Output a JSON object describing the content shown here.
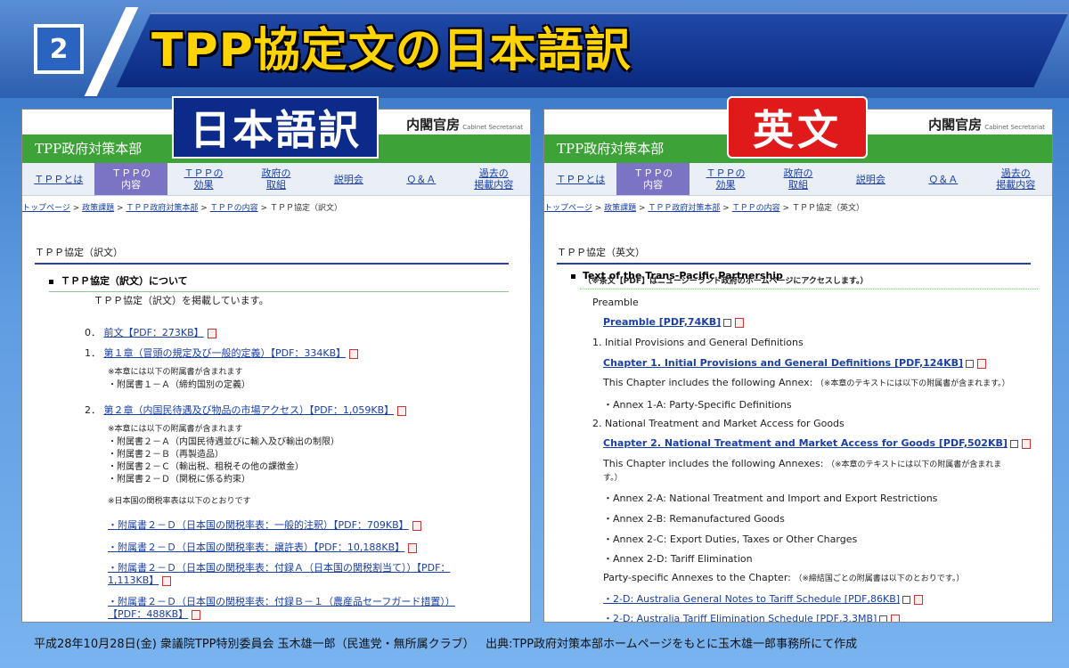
{
  "slide": {
    "number": "2",
    "title": "TPP協定文の日本語訳",
    "label_jp": "日本語訳",
    "label_en": "英文",
    "footer_left": "平成28年10月28日(金) 衆議院TPP特別委員会 玉木雄一郎（民進党・無所属クラブ）",
    "footer_right": "出典:TPP政府対策本部ホームページをもとに玉木雄一郎事務所にて作成"
  },
  "site": {
    "cabinet": "内閣官房",
    "cabinet_sub": "Cabinet Secretariat",
    "header": "TPP政府対策本部",
    "nav": [
      "ＴＰＰとは",
      "ＴＰＰの\n内容",
      "ＴＰＰの\n効果",
      "政府の\n取組",
      "説明会",
      "Ｑ＆Ａ",
      "過去の\n掲載内容"
    ],
    "crumbs": [
      "トップページ",
      "政策課題",
      "ＴＰＰ政府対策本部",
      "ＴＰＰの内容"
    ]
  },
  "left": {
    "crumb_current": "ＴＰＰ協定（訳文）",
    "section_title": "ＴＰＰ協定（訳文）",
    "sub_heading": "ＴＰＰ協定（訳文）について",
    "intro": "ＴＰＰ協定（訳文）を掲載しています。",
    "item0": {
      "num": "0．",
      "link": "前文【PDF：273KB】"
    },
    "item1": {
      "num": "1．",
      "link": "第１章（冒頭の規定及び一般的定義）【PDF：334KB】"
    },
    "item1_note": "※本章には以下の附属書が含まれます",
    "item1_annex": "・附属書１－Ａ（締約国別の定義）",
    "item2": {
      "num": "2．",
      "link": "第２章（内国民待遇及び物品の市場アクセス）【PDF：1,059KB】"
    },
    "item2_note": "※本章には以下の附属書が含まれます",
    "item2_annexes": [
      "・附属書２－Ａ（内国民待遇並びに輸入及び輸出の制限）",
      "・附属書２－Ｂ（再製造品）",
      "・附属書２－Ｃ（輸出税、租税その他の課徴金）",
      "・附属書２－Ｄ（関税に係る約束）"
    ],
    "tariff_note": "※日本国の関税率表は以下のとおりです",
    "tariff_links": [
      "・附属書２－Ｄ（日本国の関税率表：一般的注釈）【PDF：709KB】",
      "・附属書２－Ｄ（日本国の関税率表：譲許表）【PDF：10,188KB】",
      "・附属書２－Ｄ（日本国の関税率表：付録Ａ（日本国の関税割当て））【PDF：",
      "1,113KB】",
      "・附属書２－Ｄ（日本国の関税率表：付録Ｂ－１（農産品セーフガード措置））",
      "【PDF：488KB】"
    ]
  },
  "right": {
    "crumb_current": "ＴＰＰ協定（英文）",
    "section_title": "ＴＰＰ協定（英文）",
    "sub_heading": "Text of the Trans-Pacific Partnership",
    "sub_note": "（※条文【PDF】はニュージーランド政府のホームページにアクセスします。）",
    "preamble_label": "Preamble",
    "preamble_link": "Preamble [PDF,74KB]",
    "ch1_label": "1. Initial Provisions and General Definitions",
    "ch1_link": "Chapter 1. Initial Provisions and General Definitions [PDF,124KB]",
    "ch1_note": "This Chapter includes the following Annex:",
    "ch1_note_jp": "（※本章のテキストには以下の附属書が含まれます。）",
    "ch1_annex": "・Annex 1-A: Party-Specific Definitions",
    "ch2_label": "2. National Treatment and Market Access for Goods",
    "ch2_link": "Chapter 2. National Treatment and Market Access for Goods [PDF,502KB]",
    "ch2_note": "This Chapter includes the following Annexes:",
    "ch2_note_jp": "（※本章のテキストには以下の附属書が含まれま",
    "ch2_note_jp2": "す。）",
    "ch2_annexes": [
      "・Annex 2-A: National Treatment and Import and Export Restrictions",
      "・Annex 2-B: Remanufactured Goods",
      "・Annex 2-C: Export Duties, Taxes or Other Charges",
      "・Annex 2-D: Tariff Elimination"
    ],
    "party_note": "Party-specific Annexes to the Chapter:",
    "party_note_jp": "（※締結国ごとの附属書は以下のとおりです。）",
    "party_links": [
      "・2-D: Australia General Notes to Tariff Schedule [PDF,86KB]",
      "・2-D: Australia Tariff Elimination Schedule [PDF,3.3MB]"
    ]
  }
}
